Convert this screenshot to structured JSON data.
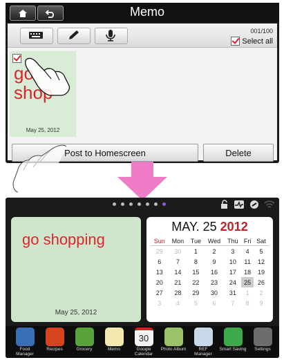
{
  "memo_app": {
    "title": "Memo",
    "counter": "001/100",
    "select_all": "Select all",
    "note": {
      "text": "go\nshop",
      "date": "May 25, 2012"
    },
    "post_button": "Post to Homescreen",
    "delete_button": "Delete"
  },
  "homescreen": {
    "memo_widget": {
      "text": "go shopping",
      "date": "May 25, 2012"
    },
    "calendar": {
      "month_day": "MAY. 25",
      "year": "2012",
      "weekdays": [
        "Sun",
        "Mon",
        "Tue",
        "Wed",
        "Thu",
        "Fri",
        "Sat"
      ],
      "weeks": [
        [
          "29",
          "30",
          "1",
          "2",
          "3",
          "4",
          "5"
        ],
        [
          "6",
          "7",
          "8",
          "9",
          "10",
          "11",
          "12"
        ],
        [
          "13",
          "14",
          "15",
          "16",
          "17",
          "18",
          "19"
        ],
        [
          "20",
          "21",
          "22",
          "23",
          "24",
          "25",
          "26"
        ],
        [
          "27",
          "28",
          "29",
          "30",
          "31",
          "1",
          "2"
        ],
        [
          "3",
          "4",
          "5",
          "6",
          "7",
          "8",
          "9"
        ]
      ],
      "today": "25"
    },
    "dock_apps": [
      {
        "label": "Food Manager",
        "color": "#3a6fb5"
      },
      {
        "label": "Recipes",
        "color": "#d8431f"
      },
      {
        "label": "Grocery",
        "color": "#5aa23a"
      },
      {
        "label": "Memo",
        "color": "#f1e8b0"
      },
      {
        "label": "Google Calendar",
        "color": "#f4f4f4"
      },
      {
        "label": "Photo Album",
        "color": "#9bc26a"
      },
      {
        "label": "REF Manager",
        "color": "#c8d8e8"
      },
      {
        "label": "Smart Saving",
        "color": "#3ea94a"
      },
      {
        "label": "Settings",
        "color": "#6c6c6c"
      }
    ],
    "calendar_icon_day": "30"
  }
}
